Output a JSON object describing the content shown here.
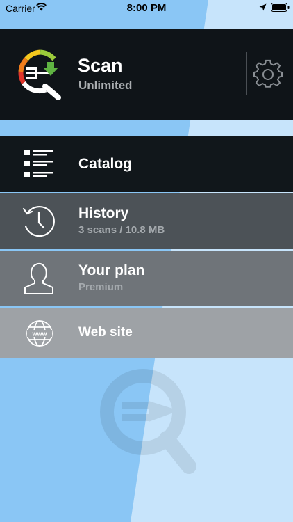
{
  "status_bar": {
    "carrier": "Carrier",
    "time": "8:00 PM"
  },
  "header": {
    "title": "Scan",
    "subtitle": "Unlimited"
  },
  "menu": {
    "catalog": {
      "title": "Catalog"
    },
    "history": {
      "title": "History",
      "subtitle": "3 scans / 10.8 MB"
    },
    "plan": {
      "title": "Your plan",
      "subtitle": "Premium"
    },
    "website": {
      "title": "Web site"
    }
  },
  "colors": {
    "header_bg": "#0f1418",
    "catalog_bg": "#11171b",
    "history_bg": "#4c5257",
    "plan_bg": "#6f7479",
    "website_bg": "#9ea2a6",
    "sky_blue": "#8ac6f5",
    "light_blue": "#c7e4fb"
  },
  "icons": {
    "app_logo": "scan-fork-magnifier-logo",
    "settings": "gear-icon",
    "catalog": "list-icon",
    "history": "clock-history-icon",
    "plan": "person-icon",
    "website": "globe-www-icon",
    "wifi": "wifi-icon",
    "location": "location-arrow-icon",
    "battery": "battery-icon"
  }
}
